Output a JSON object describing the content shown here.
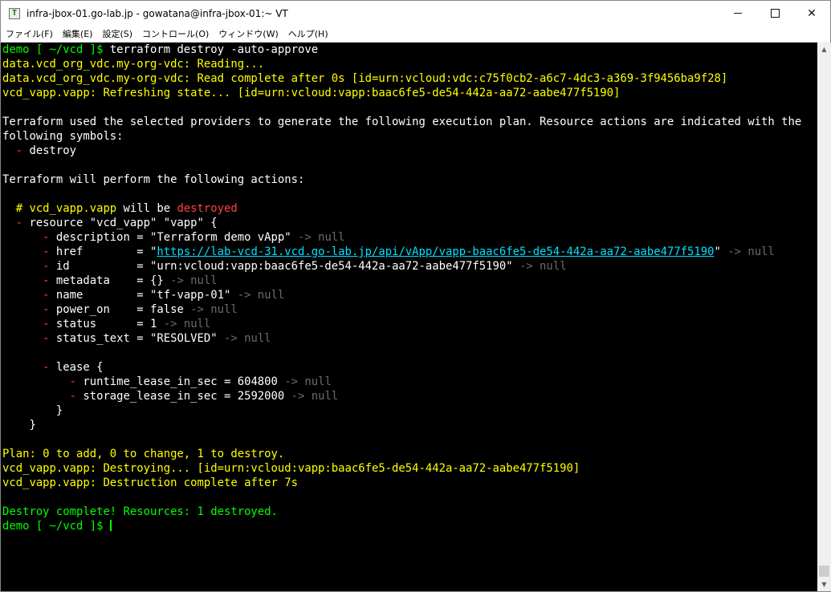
{
  "window": {
    "title": "infra-jbox-01.go-lab.jp - gowatana@infra-jbox-01:~ VT",
    "icon_glyph": "T",
    "controls": {
      "minimize": "minimize-icon",
      "maximize": "maximize-icon",
      "close": "✕"
    }
  },
  "menu": [
    "ファイル(F)",
    "編集(E)",
    "設定(S)",
    "コントロール(O)",
    "ウィンドウ(W)",
    "ヘルプ(H)"
  ],
  "colors": {
    "background": "#000000",
    "prompt": "#00ff00",
    "info": "#ffff00",
    "text": "#ffffff",
    "destroy": "#ff4040",
    "null_arrow": "#6b6b6b",
    "link": "#00e0ff"
  },
  "terminal": {
    "l1": {
      "prompt": "demo [ ~/vcd ]$",
      "command": " terraform destroy -auto-approve"
    },
    "l2": "data.vcd_org_vdc.my-org-vdc: Reading...",
    "l3": "data.vcd_org_vdc.my-org-vdc: Read complete after 0s [id=urn:vcloud:vdc:c75f0cb2-a6c7-4dc3-a369-3f9456ba9f28]",
    "l4": "vcd_vapp.vapp: Refreshing state... [id=urn:vcloud:vapp:baac6fe5-de54-442a-aa72-aabe477f5190]",
    "l6": "Terraform used the selected providers to generate the following execution plan. Resource actions are indicated with the",
    "l7": "following symbols:",
    "l8": {
      "sym": "  - ",
      "text": "destroy"
    },
    "l10": "Terraform will perform the following actions:",
    "l12": {
      "hash": "  # ",
      "res": "vcd_vapp.vapp",
      "mid": " will be ",
      "act": "destroyed"
    },
    "l13": {
      "sym": "  - ",
      "text": "resource \"vcd_vapp\" \"vapp\" {"
    },
    "attrs": {
      "description": {
        "key": "description",
        "val": "\"Terraform demo vApp\"",
        "arrow": " -> null"
      },
      "href": {
        "key": "href       ",
        "q1": "\"",
        "link": "https://lab-vcd-31.vcd.go-lab.jp/api/vApp/vapp-baac6fe5-de54-442a-aa72-aabe477f5190",
        "q2": "\"",
        "arrow": " -> null"
      },
      "id": {
        "key": "id         ",
        "val": "\"urn:vcloud:vapp:baac6fe5-de54-442a-aa72-aabe477f5190\"",
        "arrow": " -> null"
      },
      "metadata": {
        "key": "metadata   ",
        "val": "{}",
        "arrow": " -> null"
      },
      "name": {
        "key": "name       ",
        "val": "\"tf-vapp-01\"",
        "arrow": " -> null"
      },
      "power_on": {
        "key": "power_on   ",
        "val": "false",
        "arrow": " -> null"
      },
      "status": {
        "key": "status     ",
        "val": "1",
        "arrow": " -> null"
      },
      "status_text": {
        "key": "status_text",
        "val": "\"RESOLVED\"",
        "arrow": " -> null"
      }
    },
    "lease": {
      "sym": "      - ",
      "text": "lease {"
    },
    "lease_attrs": {
      "runtime": {
        "key": "runtime_lease_in_sec",
        "val": "604800",
        "arrow": " -> null"
      },
      "storage": {
        "key": "storage_lease_in_sec",
        "val": "2592000",
        "arrow": " -> null"
      }
    },
    "close_inner": "        }",
    "close_outer": "    }",
    "plan": "Plan: 0 to add, 0 to change, 1 to destroy.",
    "destroying": "vcd_vapp.vapp: Destroying... [id=urn:vcloud:vapp:baac6fe5-de54-442a-aa72-aabe477f5190]",
    "destroyed": "vcd_vapp.vapp: Destruction complete after 7s",
    "complete": "Destroy complete! Resources: 1 destroyed.",
    "final_prompt": "demo [ ~/vcd ]$"
  },
  "scrollbar": {
    "up": "▲",
    "down": "▼"
  }
}
